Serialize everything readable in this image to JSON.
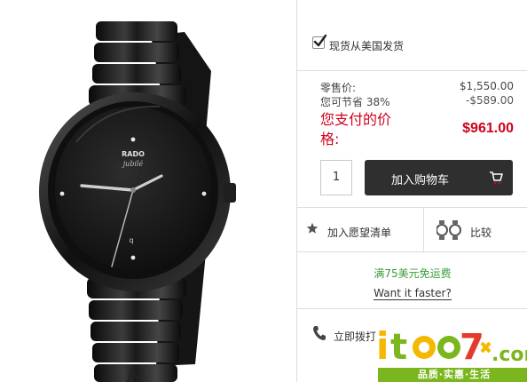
{
  "shipping": {
    "label": "现货从美国发货",
    "checked": true
  },
  "pricing": {
    "retail_label": "零售价:",
    "retail_value": "$1,550.00",
    "savings_label": "您可节省 38%",
    "savings_value": "-$589.00",
    "pay_label": "您支付的价格:",
    "pay_value": "$961.00",
    "accent_color": "#d0021b"
  },
  "purchase": {
    "quantity": "1",
    "add_to_cart_label": "加入购物车"
  },
  "actions": {
    "wishlist_label": "加入愿望清单",
    "compare_label": "比较"
  },
  "shipping_info": {
    "free_shipping": "满75美元免运费",
    "faster_link": "Want it faster?"
  },
  "contact": {
    "call_label": "立即拨打"
  },
  "product": {
    "brand": "RADO",
    "model": "jubilé"
  },
  "watermark": {
    "tagline": "品质·实惠·生活"
  },
  "icons": [
    "checkmark-icon",
    "cart-icon",
    "star-icon",
    "watch-pair-icon",
    "phone-icon"
  ]
}
